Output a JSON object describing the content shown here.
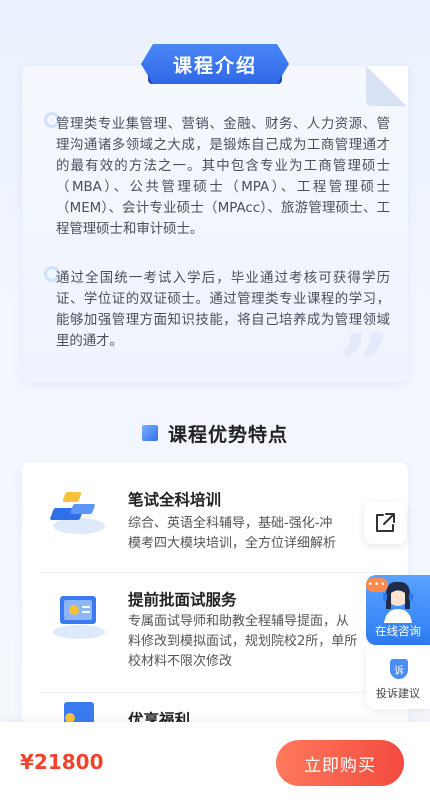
{
  "intro": {
    "title": "课程介绍",
    "paragraph1": "管理类专业集管理、营销、金融、财务、人力资源、管理沟通诸多领域之大成，是锻炼自己成为工商管理通才的最有效的方法之一。其中包含专业为工商管理硕士（MBA）、公共管理硕士（MPA）、工程管理硕士（MEM）、会计专业硕士（MPAcc）、旅游管理硕士、工程管理硕士和审计硕士。",
    "paragraph2": "通过全国统一考试入学后，毕业通过考核可获得学历证、学位证的双证硕士。通过管理类专业课程的学习，能够加强管理方面知识技能，将自己培养成为管理领域里的通才。"
  },
  "advantages": {
    "title": "课程优势特点",
    "items": [
      {
        "title": "笔试全科培训",
        "line1": "综合、英语全科辅导，基础-强化-冲",
        "line2": "模考四大模块培训，全方位详细解析"
      },
      {
        "title": "提前批面试服务",
        "line1": "专属面试导师和助教全程辅导提面，从",
        "line2": "料修改到模拟面试，规划院校2所，单所",
        "line3": "校材料不限次修改"
      },
      {
        "title": "优享福利"
      }
    ]
  },
  "floating": {
    "share_icon": "share-external-icon",
    "consult_label": "在线咨询",
    "bubble": "•••",
    "complaint_badge": "诉",
    "complaint_label": "投诉建议"
  },
  "bottom_bar": {
    "price": "¥21800",
    "buy_label": "立即购买"
  },
  "colors": {
    "primary": "#2f68e8",
    "price": "#f0442f",
    "buy_button": "#f34a3f"
  }
}
